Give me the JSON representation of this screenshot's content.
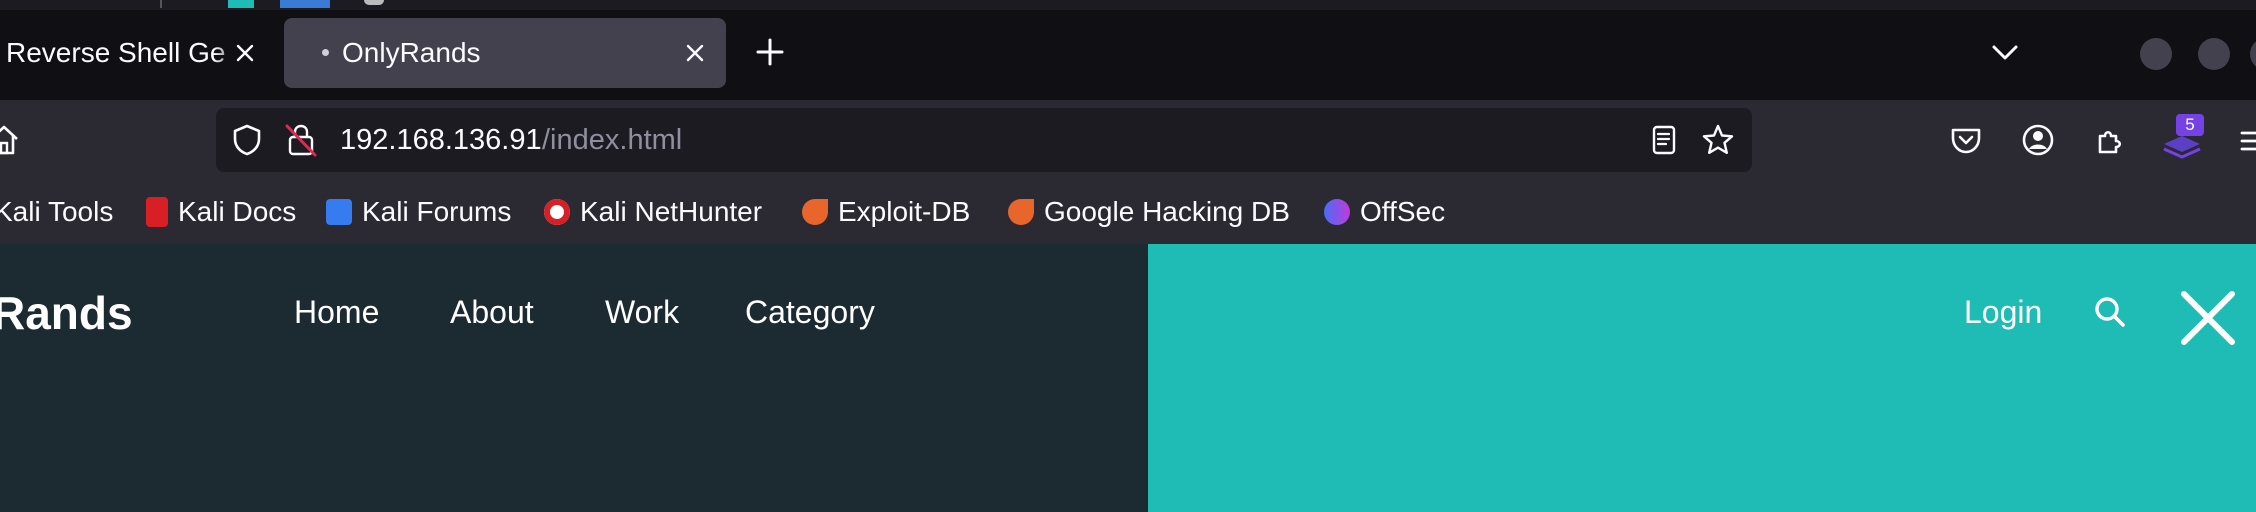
{
  "browser": {
    "tabs": [
      {
        "title": "Reverse Shell Ge",
        "active": false
      },
      {
        "title": "OnlyRands",
        "active": true
      }
    ],
    "new_tab_glyph": "+",
    "address": {
      "host": "192.168.136.91",
      "path": "/index.html"
    },
    "bookmarks": [
      {
        "label": "Kali Tools",
        "icon": "kali-icon"
      },
      {
        "label": "Kali Docs",
        "icon": "kali-docs-icon"
      },
      {
        "label": "Kali Forums",
        "icon": "kali-forums-icon"
      },
      {
        "label": "Kali NetHunter",
        "icon": "nethunter-icon"
      },
      {
        "label": "Exploit-DB",
        "icon": "exploit-db-icon"
      },
      {
        "label": "Google Hacking DB",
        "icon": "ghdb-icon"
      },
      {
        "label": "OffSec",
        "icon": "offsec-icon"
      }
    ],
    "extension_badge": "5"
  },
  "site": {
    "brand": "Rands",
    "nav": [
      "Home",
      "About",
      "Work",
      "Category"
    ],
    "login": "Login"
  },
  "colors": {
    "page_left": "#1c2b31",
    "page_right": "#1fbcb6",
    "badge": "#7542e5"
  }
}
